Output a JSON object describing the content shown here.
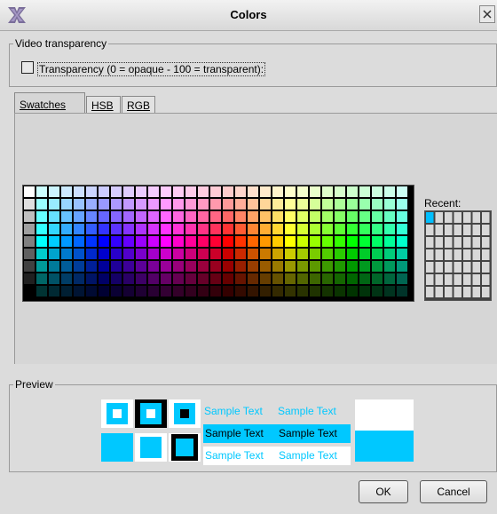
{
  "window": {
    "title": "Colors",
    "logo_icon": "x-logo-icon",
    "close_icon": "close-icon"
  },
  "video_transparency": {
    "legend": "Video transparency",
    "checkbox_label": "Transparency (0 = opaque - 100 = transparent):",
    "checked": false
  },
  "tabs": [
    {
      "label": "Swatches",
      "active": true
    },
    {
      "label": "HSB",
      "active": false
    },
    {
      "label": "RGB",
      "active": false
    }
  ],
  "swatches": {
    "recent_label": "Recent:",
    "recent_selected": "#00bfff"
  },
  "preview": {
    "legend": "Preview",
    "foreground": "#00c8ff",
    "background": "#ffffff",
    "sample_text": "Sample Text"
  },
  "buttons": {
    "ok": "OK",
    "cancel": "Cancel"
  }
}
